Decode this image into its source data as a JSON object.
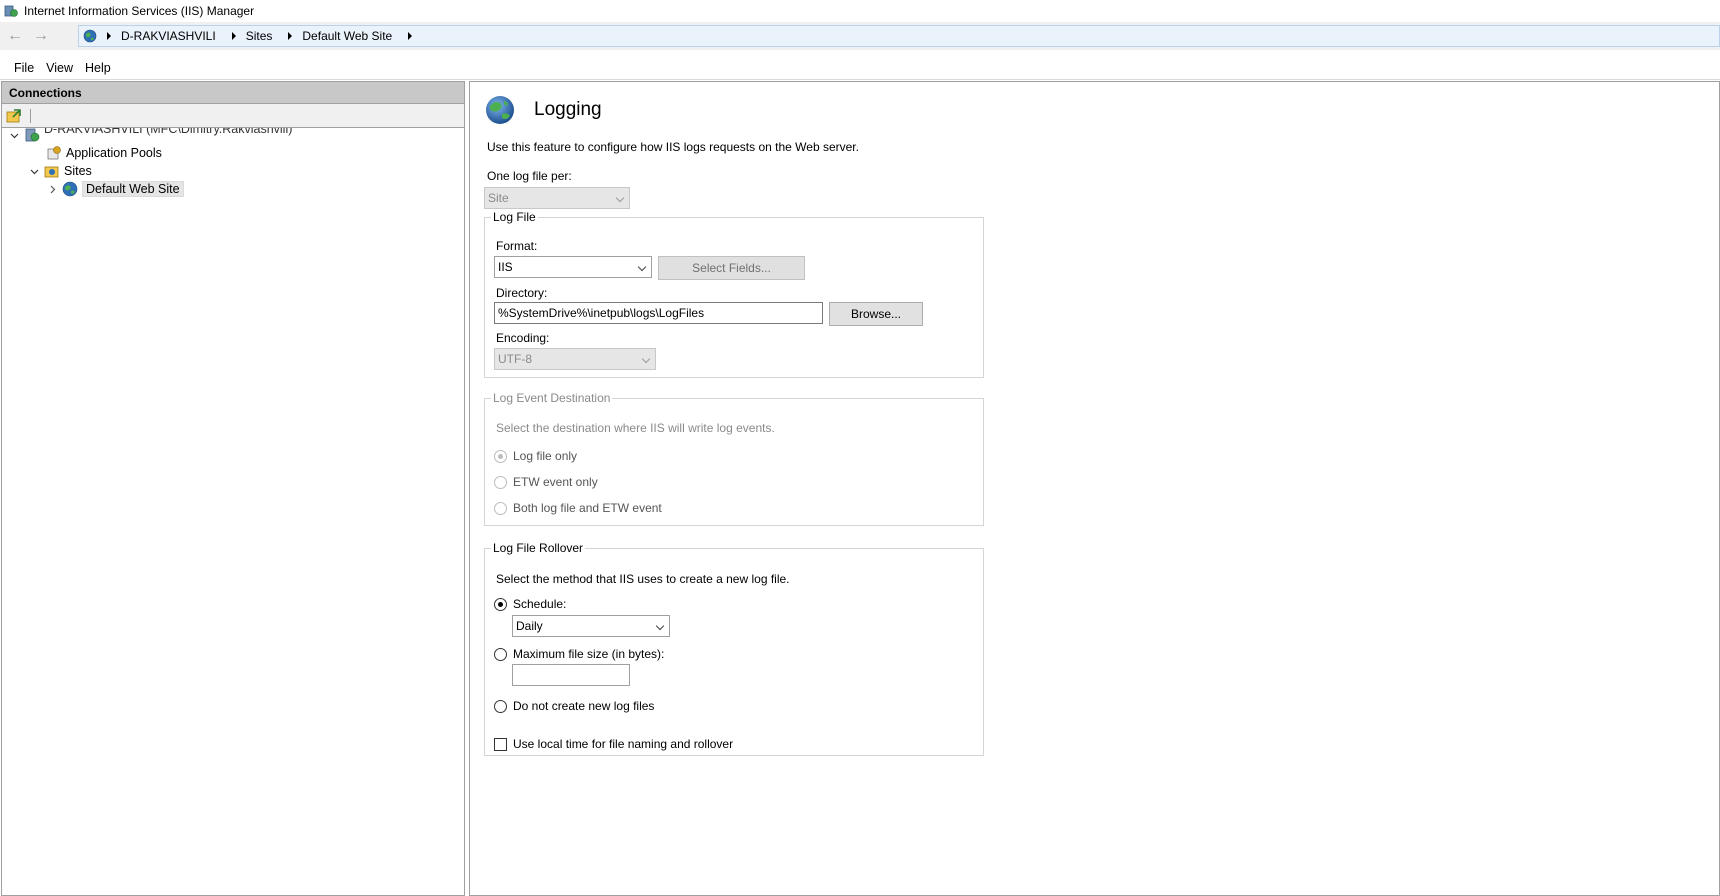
{
  "window": {
    "title": "Internet Information Services (IIS) Manager"
  },
  "address": {
    "crumbs": [
      "D-RAKVIASHVILI",
      "Sites",
      "Default Web Site"
    ]
  },
  "menu": {
    "file": "File",
    "view": "View",
    "help": "Help"
  },
  "connections": {
    "header": "Connections",
    "tree": {
      "server": "D-RAKVIASHVILI (MFC\\Dimitry.Rakviashvili)",
      "app_pools": "Application Pools",
      "sites": "Sites",
      "default_site": "Default Web Site"
    }
  },
  "feature": {
    "title": "Logging",
    "description": "Use this feature to configure how IIS logs requests on the Web server.",
    "one_log_label": "One log file per:",
    "one_log_value": "Site",
    "log_file": {
      "legend": "Log File",
      "format_label": "Format:",
      "format_value": "IIS",
      "select_fields": "Select Fields...",
      "directory_label": "Directory:",
      "directory_value": "%SystemDrive%\\inetpub\\logs\\LogFiles",
      "browse": "Browse...",
      "encoding_label": "Encoding:",
      "encoding_value": "UTF-8"
    },
    "log_event": {
      "legend": "Log Event Destination",
      "description": "Select the destination where IIS will write log events.",
      "opt_file": "Log file only",
      "opt_etw": "ETW event only",
      "opt_both": "Both log file and ETW event"
    },
    "rollover": {
      "legend": "Log File Rollover",
      "description": "Select the method that IIS uses to create a new log file.",
      "schedule_label": "Schedule:",
      "schedule_value": "Daily",
      "max_size_label": "Maximum file size (in bytes):",
      "max_size_value": "",
      "no_new_label": "Do not create new log files",
      "local_time_label": "Use local time for file naming and rollover"
    }
  }
}
